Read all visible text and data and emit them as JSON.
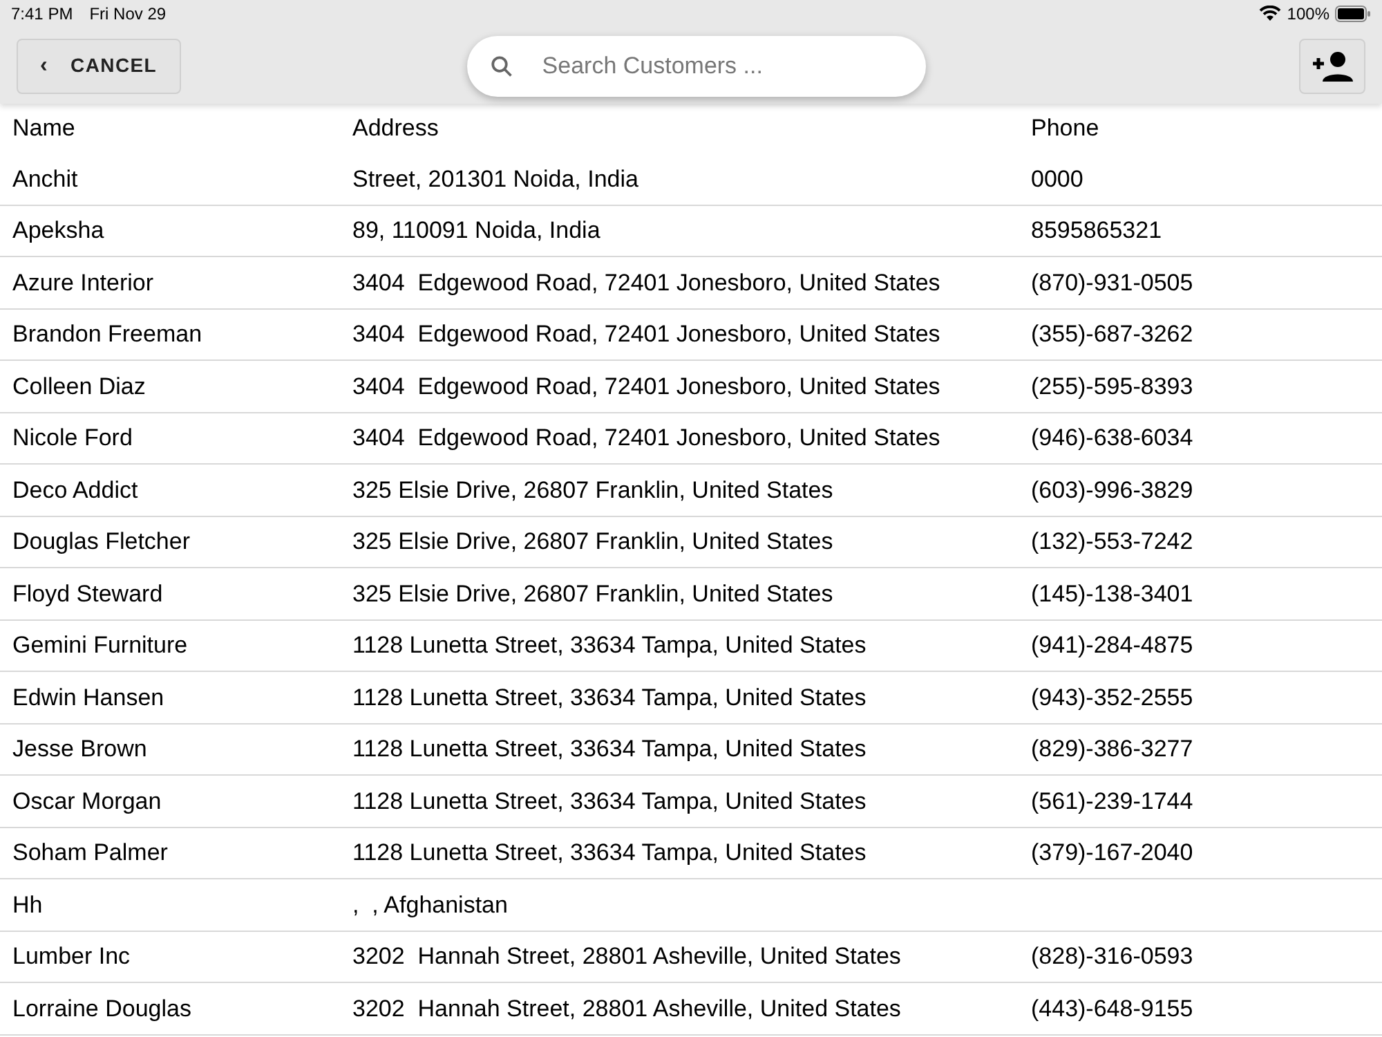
{
  "status_bar": {
    "time": "7:41 PM",
    "date": "Fri Nov 29",
    "battery": "100%"
  },
  "toolbar": {
    "cancel": "CANCEL",
    "cancel_icon": "‹",
    "search": {
      "placeholder": "Search Customers ..."
    }
  },
  "table": {
    "columns": [
      "Name",
      "Address",
      "Phone"
    ],
    "rows": [
      {
        "name": "Anchit",
        "address": "Street, 201301 Noida, India",
        "phone": "0000"
      },
      {
        "name": "Apeksha",
        "address": "89, 110091 Noida, India",
        "phone": "8595865321"
      },
      {
        "name": "Azure Interior",
        "address": "3404  Edgewood Road, 72401 Jonesboro, United States",
        "phone": "(870)-931-0505"
      },
      {
        "name": "Brandon Freeman",
        "address": "3404  Edgewood Road, 72401 Jonesboro, United States",
        "phone": "(355)-687-3262"
      },
      {
        "name": "Colleen Diaz",
        "address": "3404  Edgewood Road, 72401 Jonesboro, United States",
        "phone": "(255)-595-8393"
      },
      {
        "name": "Nicole Ford",
        "address": "3404  Edgewood Road, 72401 Jonesboro, United States",
        "phone": "(946)-638-6034"
      },
      {
        "name": "Deco Addict",
        "address": "325 Elsie Drive, 26807 Franklin, United States",
        "phone": "(603)-996-3829"
      },
      {
        "name": "Douglas Fletcher",
        "address": "325 Elsie Drive, 26807 Franklin, United States",
        "phone": "(132)-553-7242"
      },
      {
        "name": "Floyd Steward",
        "address": "325 Elsie Drive, 26807 Franklin, United States",
        "phone": "(145)-138-3401"
      },
      {
        "name": "Gemini Furniture",
        "address": "1128 Lunetta Street, 33634 Tampa, United States",
        "phone": "(941)-284-4875"
      },
      {
        "name": "Edwin Hansen",
        "address": "1128 Lunetta Street, 33634 Tampa, United States",
        "phone": "(943)-352-2555"
      },
      {
        "name": "Jesse Brown",
        "address": "1128 Lunetta Street, 33634 Tampa, United States",
        "phone": "(829)-386-3277"
      },
      {
        "name": "Oscar Morgan",
        "address": "1128 Lunetta Street, 33634 Tampa, United States",
        "phone": "(561)-239-1744"
      },
      {
        "name": "Soham Palmer",
        "address": "1128 Lunetta Street, 33634 Tampa, United States",
        "phone": "(379)-167-2040"
      },
      {
        "name": "Hh",
        "address": ",  , Afghanistan"
      },
      {
        "name": "Lumber Inc",
        "address": "3202  Hannah Street, 28801 Asheville, United States",
        "phone": "(828)-316-0593"
      },
      {
        "name": "Lorraine Douglas",
        "address": "3202  Hannah Street, 28801 Asheville, United States",
        "phone": "(443)-648-9155"
      }
    ]
  }
}
